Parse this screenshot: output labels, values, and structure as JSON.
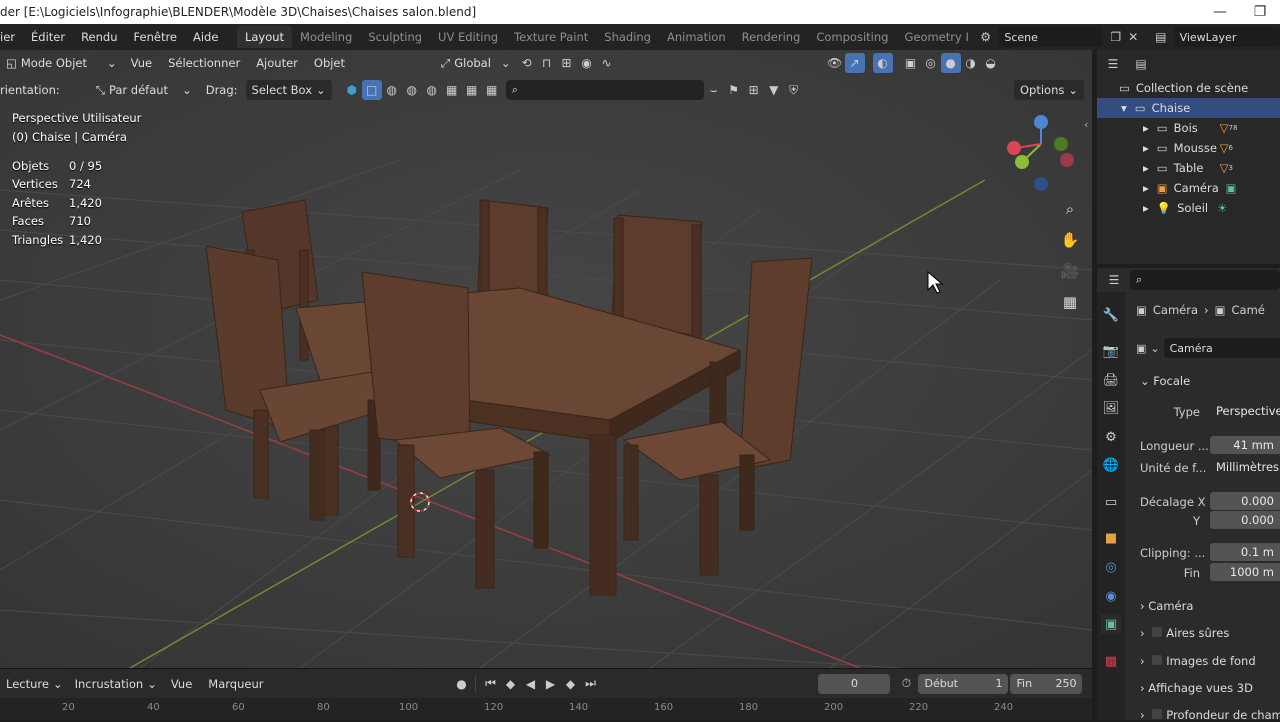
{
  "title_bar": {
    "text": "der [E:\\Logiciels\\Infographie\\BLENDER\\Modèle 3D\\Chaises\\Chaises salon.blend]",
    "minimize": "—",
    "restore": "❐"
  },
  "menus": [
    "ier",
    "Éditer",
    "Rendu",
    "Fenêtre",
    "Aide"
  ],
  "workspaces": [
    "Layout",
    "Modeling",
    "Sculpting",
    "UV Editing",
    "Texture Paint",
    "Shading",
    "Animation",
    "Rendering",
    "Compositing",
    "Geometry I"
  ],
  "scene": {
    "label": "Scene",
    "view_layer": "ViewLayer"
  },
  "viewport_header": {
    "mode": "Mode Objet",
    "menu_vue": "Vue",
    "menu_select": "Sélectionner",
    "menu_add": "Ajouter",
    "menu_object": "Objet",
    "transform": "Global"
  },
  "tool_header": {
    "orientation_label": "rientation:",
    "orientation_value": "Par défaut",
    "drag_label": "Drag:",
    "drag_value": "Select Box",
    "options": "Options"
  },
  "overlay": {
    "view_name": "Perspective Utilisateur",
    "context": "(0) Chaise | Caméra",
    "stats": [
      {
        "label": "Objets",
        "value": "0 / 95"
      },
      {
        "label": "Vertices",
        "value": "724"
      },
      {
        "label": "Arêtes",
        "value": "1,420"
      },
      {
        "label": "Faces",
        "value": "710"
      },
      {
        "label": "Triangles",
        "value": "1,420"
      }
    ]
  },
  "outliner": {
    "collection": "Collection de scène",
    "items": [
      {
        "label": "Chaise",
        "level": 1,
        "badge": ""
      },
      {
        "label": "Bois",
        "level": 2,
        "badge": "78"
      },
      {
        "label": "Mousse",
        "level": 2,
        "badge": "6"
      },
      {
        "label": "Table",
        "level": 2,
        "badge": "3"
      },
      {
        "label": "Caméra",
        "level": 2,
        "badge": ""
      },
      {
        "label": "Soleil",
        "level": 2,
        "badge": ""
      }
    ]
  },
  "properties": {
    "breadcrumb": [
      "Caméra",
      "Camé"
    ],
    "datablock": "Caméra",
    "section": "Focale",
    "type_label": "Type",
    "type_value": "Perspective",
    "focal_label": "Longueur ...",
    "focal_value": "41 mm",
    "unit_label": "Unité de f...",
    "unit_value": "Millimètres",
    "shift_x_label": "Décalage X",
    "shift_x_value": "0.000",
    "shift_y_label": "Y",
    "shift_y_value": "0.000",
    "clip_label": "Clipping: ...",
    "clip_value": "0.1 m",
    "clip_end_label": "Fin",
    "clip_end_value": "1000 m",
    "panels": [
      "Caméra",
      "Aires sûres",
      "Images de fond",
      "Affichage vues 3D",
      "Profondeur de champ"
    ]
  },
  "timeline": {
    "menus": [
      "Lecture",
      "Incrustation",
      "Vue",
      "Marqueur"
    ],
    "current_frame": "0",
    "start_label": "Début",
    "start_value": "1",
    "end_label": "Fin",
    "end_value": "250",
    "ruler_ticks": [
      "20",
      "40",
      "60",
      "80",
      "100",
      "120",
      "140",
      "160",
      "180",
      "200",
      "220",
      "240"
    ]
  },
  "colors": {
    "wood": "#5e3d2c",
    "viewport": "#3d3d3d",
    "accent": "#4772b3",
    "x_axis": "#c44852",
    "y_axis": "#7a9a3a"
  }
}
